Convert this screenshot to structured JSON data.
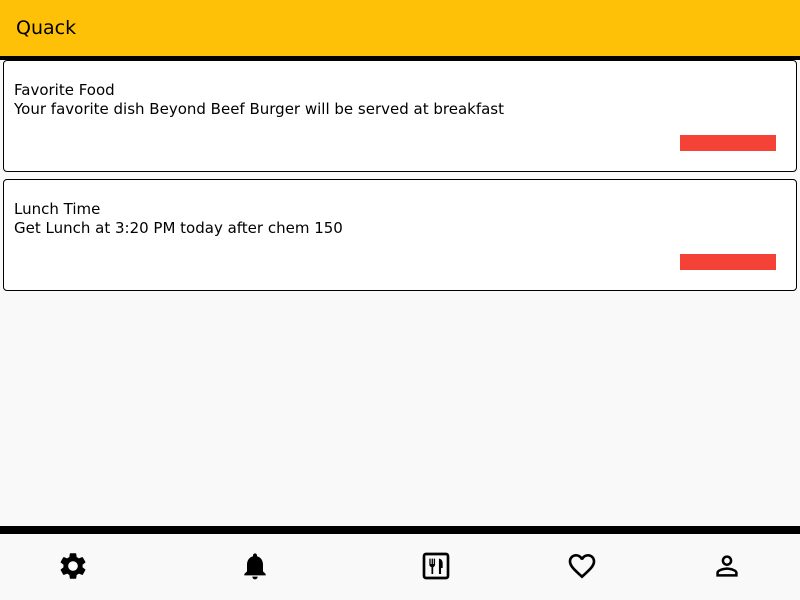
{
  "app_bar": {
    "title": "Quack",
    "color": "#ffc107"
  },
  "notifications": [
    {
      "title": "Favorite Food",
      "body": "Your favorite dish Beyond Beef Burger will be served at breakfast",
      "action_color": "#f44336"
    },
    {
      "title": "Lunch Time",
      "body": "Get Lunch at 3:20 PM today after chem 150",
      "action_color": "#f44336"
    }
  ],
  "bottom_nav": {
    "items": [
      {
        "icon": "gear-icon"
      },
      {
        "icon": "bell-icon"
      },
      {
        "icon": "menu-icon"
      },
      {
        "icon": "heart-icon"
      },
      {
        "icon": "profile-icon"
      }
    ]
  }
}
